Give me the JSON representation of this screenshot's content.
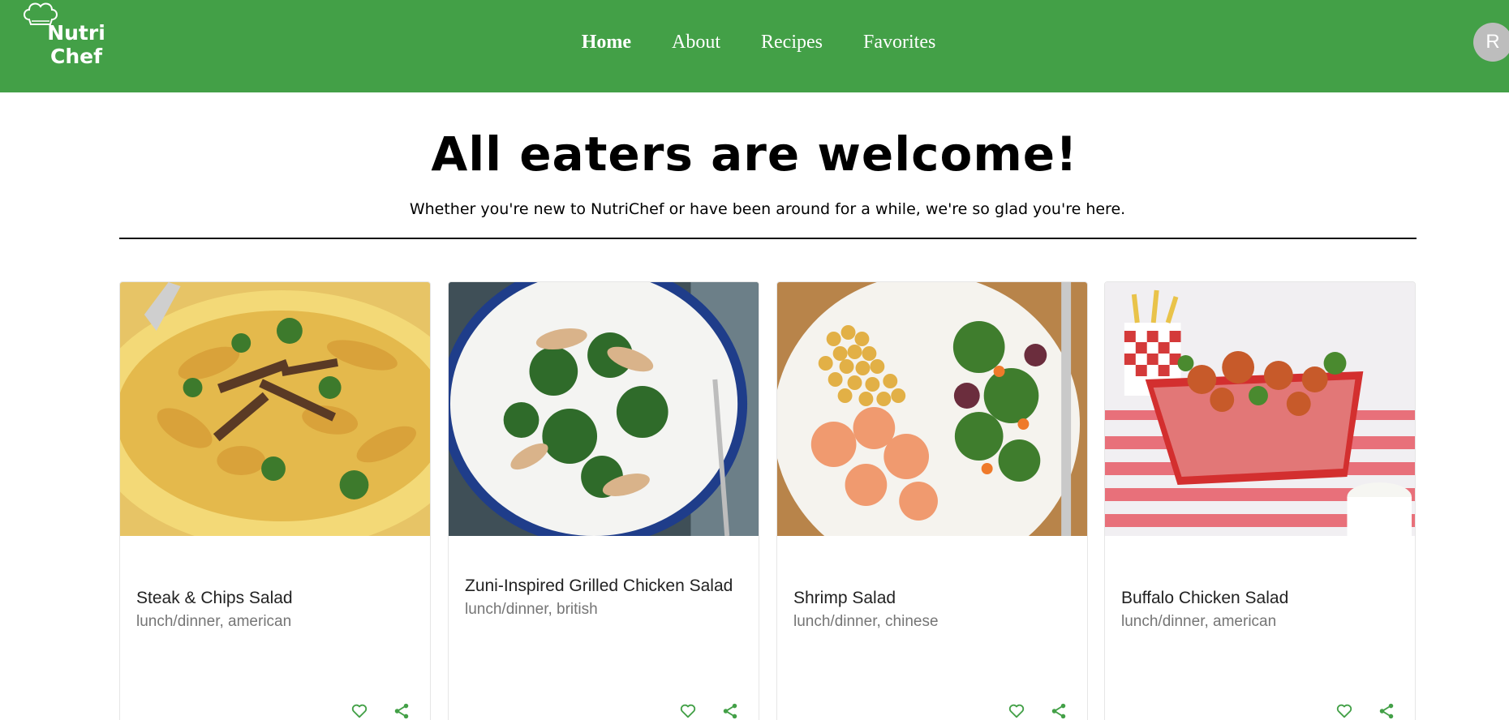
{
  "brand": {
    "logo_text_line1": "Nutri",
    "logo_text_line2": "Chef",
    "color": "#43a047"
  },
  "nav": {
    "items": [
      {
        "label": "Home",
        "active": true
      },
      {
        "label": "About",
        "active": false
      },
      {
        "label": "Recipes",
        "active": false
      },
      {
        "label": "Favorites",
        "active": false
      }
    ]
  },
  "user": {
    "avatar_initial": "R"
  },
  "hero": {
    "title": "All eaters are welcome!",
    "subtitle": "Whether you're new to NutriChef or have been around for a while, we're so glad you're here."
  },
  "recipes": [
    {
      "title": "Steak & Chips Salad",
      "tags": "lunch/dinner, american",
      "image": "steak-chips-salad-photo"
    },
    {
      "title": "Zuni-Inspired Grilled Chicken Salad",
      "tags": "lunch/dinner, british",
      "image": "grilled-chicken-salad-photo"
    },
    {
      "title": "Shrimp Salad",
      "tags": "lunch/dinner, chinese",
      "image": "shrimp-salad-photo"
    },
    {
      "title": "Buffalo Chicken Salad",
      "tags": "lunch/dinner, american",
      "image": "buffalo-chicken-salad-photo"
    }
  ],
  "icons": {
    "favorite": "heart-outline-icon",
    "share": "share-icon"
  }
}
